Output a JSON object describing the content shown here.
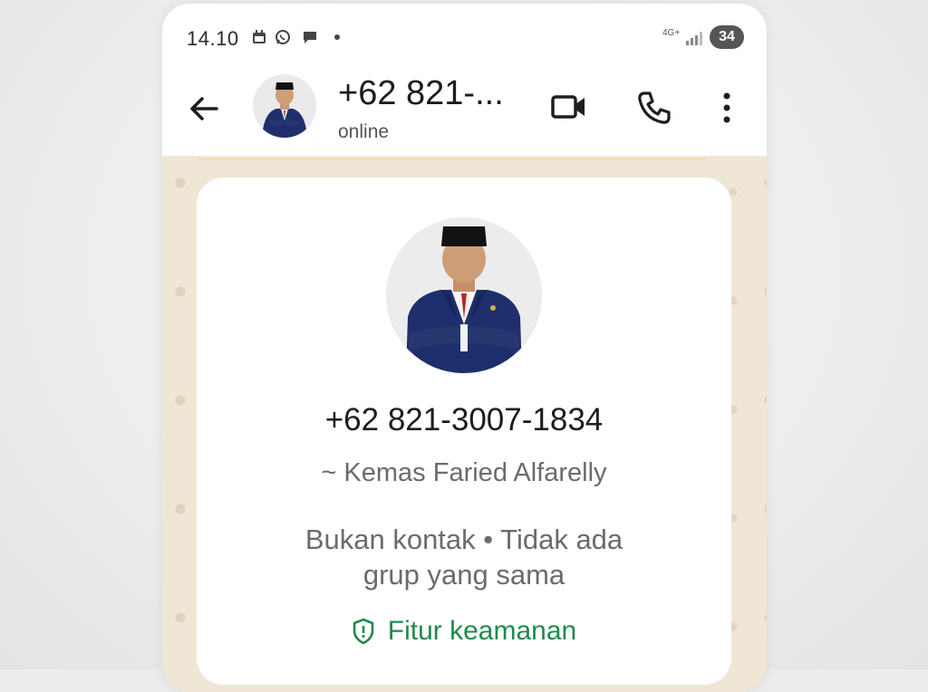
{
  "status_bar": {
    "time": "14.10",
    "network": "4G+",
    "battery": "34"
  },
  "header": {
    "contact_title": "+62 821-...",
    "presence": "online"
  },
  "profile_card": {
    "phone_number": "+62 821-3007-1834",
    "push_name": "~ Kemas Faried Alfarelly",
    "info_text": "Bukan kontak • Tidak ada grup yang sama",
    "safety_link": "Fitur keamanan"
  },
  "colors": {
    "accent_green": "#1f8a4c",
    "suit_navy": "#1f2f6d",
    "chat_background": "#efe6d6"
  },
  "icons": [
    "back-arrow-icon",
    "video-call-icon",
    "voice-call-icon",
    "more-options-icon",
    "shield-icon"
  ]
}
